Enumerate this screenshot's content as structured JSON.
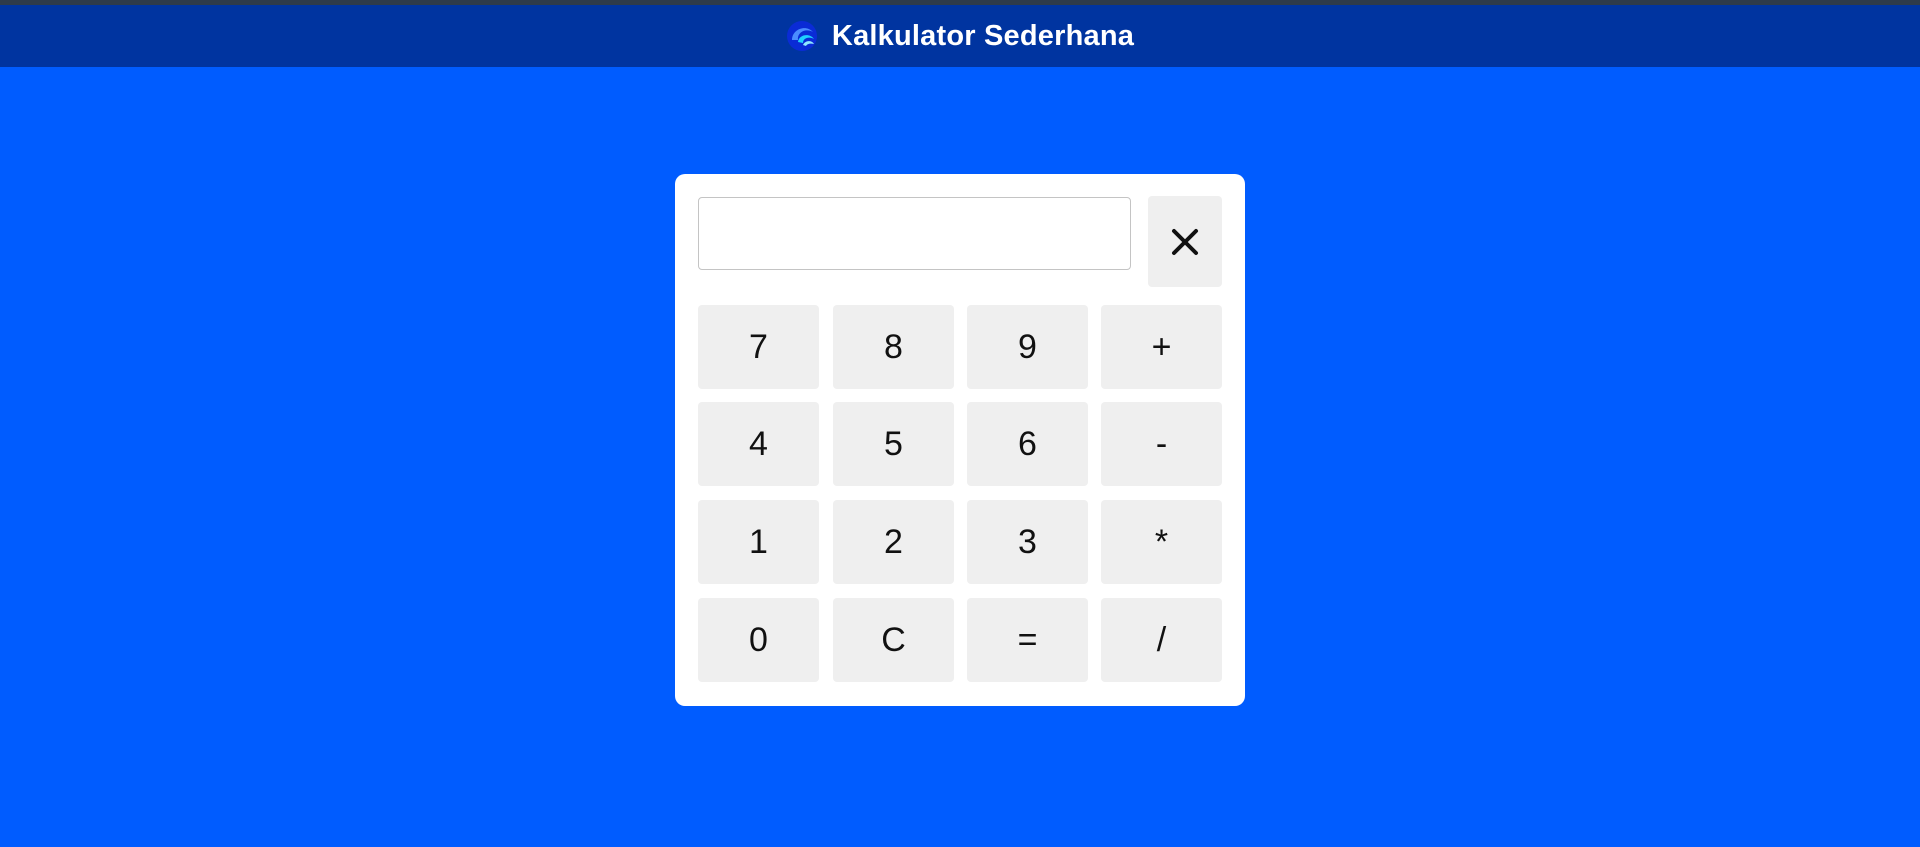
{
  "header": {
    "title": "Kalkulator Sederhana",
    "logo_icon": "swirl-logo-icon"
  },
  "calculator": {
    "display_value": "",
    "close_icon": "close-icon",
    "keys": [
      [
        "7",
        "8",
        "9",
        "+"
      ],
      [
        "4",
        "5",
        "6",
        "-"
      ],
      [
        "1",
        "2",
        "3",
        "*"
      ],
      [
        "0",
        "C",
        "=",
        "/"
      ]
    ]
  },
  "colors": {
    "page_background": "#005cff",
    "header_background": "#0034a0",
    "card_background": "#ffffff",
    "key_background": "#efefef"
  }
}
